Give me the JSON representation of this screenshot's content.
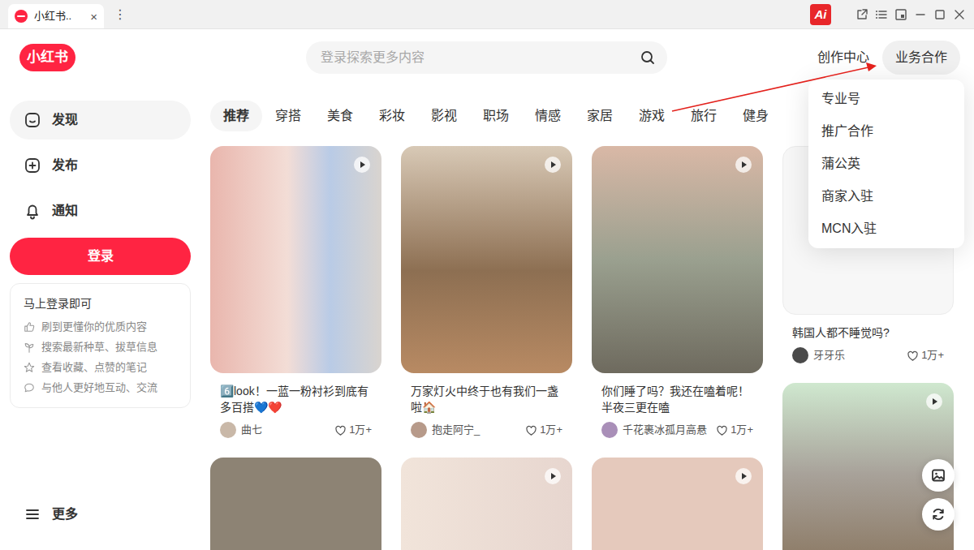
{
  "browser": {
    "tab": {
      "title": "小红书..",
      "close": "×",
      "selected": true
    },
    "menu": "⋮",
    "ai_badge": "Ai"
  },
  "header": {
    "logo": "小红书",
    "search": {
      "placeholder": "登录探索更多内容"
    },
    "creator_center": "创作中心",
    "business": {
      "label": "业务合作",
      "expanded": true
    }
  },
  "business_menu": [
    "专业号",
    "推广合作",
    "蒲公英",
    "商家入驻",
    "MCN入驻"
  ],
  "sidebar": {
    "items": [
      {
        "label": "发现",
        "kind": "discover",
        "selected": true
      },
      {
        "label": "发布",
        "kind": "publish",
        "selected": false
      },
      {
        "label": "通知",
        "kind": "notify",
        "selected": false
      }
    ],
    "login_button": "登录",
    "login_tip": {
      "title": "马上登录即可",
      "items": [
        {
          "text": "刷到更懂你的优质内容",
          "kind": "like"
        },
        {
          "text": "搜索最新种草、拔草信息",
          "kind": "sprout"
        },
        {
          "text": "查看收藏、点赞的笔记",
          "kind": "star"
        },
        {
          "text": "与他人更好地互动、交流",
          "kind": "chat"
        }
      ]
    },
    "more": "更多"
  },
  "channels": [
    {
      "label": "推荐",
      "selected": true
    },
    {
      "label": "穿搭",
      "selected": false
    },
    {
      "label": "美食",
      "selected": false
    },
    {
      "label": "彩妆",
      "selected": false
    },
    {
      "label": "影视",
      "selected": false
    },
    {
      "label": "职场",
      "selected": false
    },
    {
      "label": "情感",
      "selected": false
    },
    {
      "label": "家居",
      "selected": false
    },
    {
      "label": "游戏",
      "selected": false
    },
    {
      "label": "旅行",
      "selected": false
    },
    {
      "label": "健身",
      "selected": false
    }
  ],
  "feed": {
    "columns": [
      [
        {
          "video": true,
          "title": "6️⃣look！一蓝一粉衬衫到底有多百搭💙❤️",
          "author": "曲七",
          "likes": "1万+"
        },
        {
          "video": false
        }
      ],
      [
        {
          "video": true,
          "title": "万家灯火中终于也有我们一盏啦🏠",
          "author": "抱走阿宁_",
          "likes": "1万+"
        },
        {
          "video": true
        }
      ],
      [
        {
          "video": true,
          "title": "你们睡了吗？我还在嗑着呢！半夜三更在嗑",
          "author": "千花裹冰孤月高悬",
          "likes": "1万+"
        },
        {
          "video": true
        }
      ],
      [
        {
          "video": false,
          "title": "韩国人都不睡觉吗?",
          "author": "牙牙乐",
          "likes": "1万+"
        },
        {
          "video": true
        }
      ]
    ]
  }
}
